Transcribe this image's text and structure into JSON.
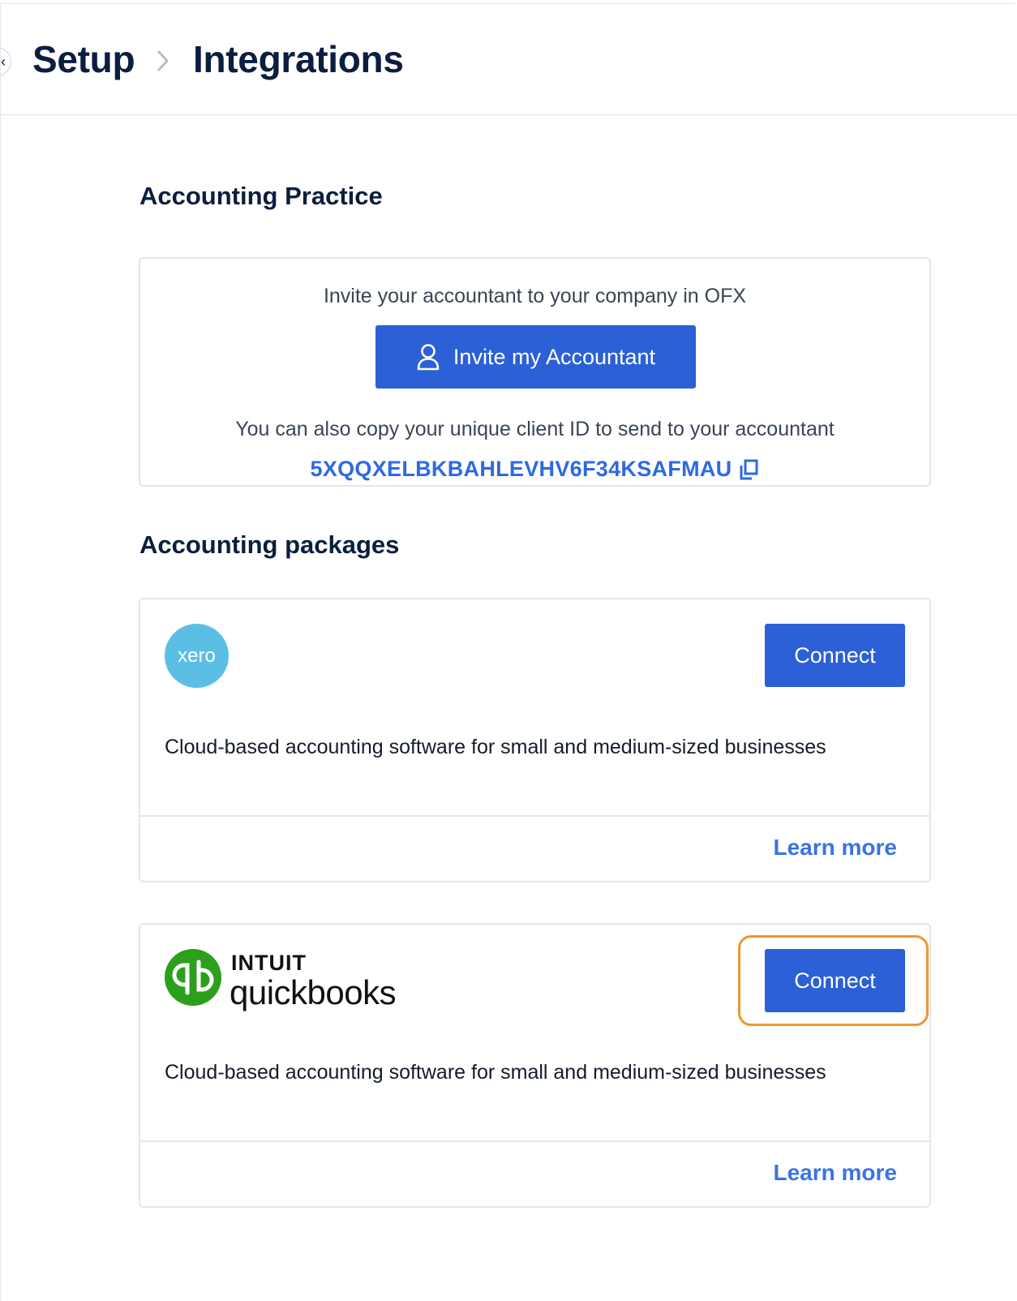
{
  "breadcrumb": {
    "root": "Setup",
    "current": "Integrations"
  },
  "accounting_practice": {
    "title": "Accounting Practice",
    "invite_text": "Invite your accountant to your company in OFX",
    "invite_button": "Invite my Accountant",
    "copy_text": "You can also copy your unique client ID to send to your accountant",
    "client_id": "5XQQXELBKBAHLEVHV6F34KSAFMAU"
  },
  "accounting_packages": {
    "title": "Accounting packages",
    "items": [
      {
        "logo": "xero",
        "logo_text": "xero",
        "connect_label": "Connect",
        "description": "Cloud-based accounting software for small and medium-sized businesses",
        "learn_more": "Learn more"
      },
      {
        "logo": "intuit-quickbooks",
        "logo_text_top": "INTUIT",
        "logo_text_bottom": "quickbooks",
        "connect_label": "Connect",
        "description": "Cloud-based accounting software for small and medium-sized businesses",
        "learn_more": "Learn more"
      }
    ]
  },
  "colors": {
    "primary_button": "#2b60d6",
    "link": "#3a73e6",
    "heading": "#0b1e3f",
    "xero": "#5bbfe5",
    "quickbooks": "#2ca01c",
    "highlight": "#f0962f"
  },
  "icons": [
    "back-arrow-icon",
    "chevron-right-icon",
    "user-icon",
    "copy-icon"
  ]
}
